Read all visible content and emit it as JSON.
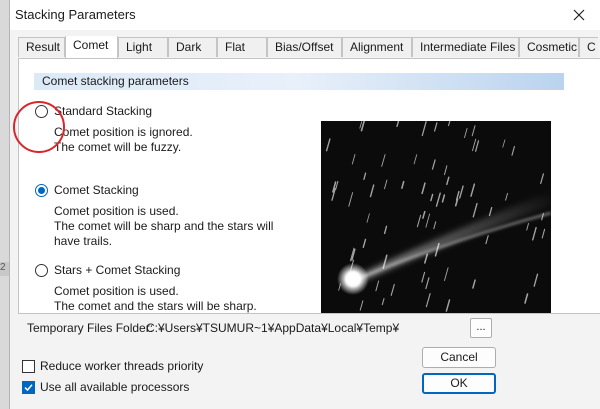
{
  "window": {
    "title": "Stacking Parameters"
  },
  "tabs": [
    {
      "label": "Result"
    },
    {
      "label": "Comet",
      "active": true
    },
    {
      "label": "Light"
    },
    {
      "label": "Dark"
    },
    {
      "label": "Flat"
    },
    {
      "label": "Bias/Offset"
    },
    {
      "label": "Alignment"
    },
    {
      "label": "Intermediate Files"
    },
    {
      "label": "Cosmetic"
    },
    {
      "label": "C"
    }
  ],
  "section": {
    "header": "Comet stacking parameters"
  },
  "options": [
    {
      "label": "Standard Stacking",
      "desc1": "Comet position is ignored.",
      "desc2": "The comet will be fuzzy.",
      "desc3": "",
      "checked": false
    },
    {
      "label": "Comet Stacking",
      "desc1": "Comet position is used.",
      "desc2": "The comet will be sharp and the stars will",
      "desc3": "have trails.",
      "checked": true
    },
    {
      "label": "Stars + Comet Stacking",
      "desc1": "Comet position is used.",
      "desc2": "The comet and the stars will be sharp.",
      "desc3": "",
      "checked": false
    }
  ],
  "temp": {
    "label": "Temporary Files Folder:",
    "path": "C:¥Users¥TSUMUR~1¥AppData¥Local¥Temp¥",
    "browse_label": "..."
  },
  "checks": [
    {
      "label": "Reduce worker threads priority",
      "checked": false
    },
    {
      "label": "Use all available processors",
      "checked": true
    }
  ],
  "buttons": {
    "cancel": "Cancel",
    "ok": "OK"
  },
  "edge": {
    "stub_text": "2"
  },
  "colors": {
    "accent": "#0067c0",
    "highlight": "#d8262d"
  },
  "icons": {
    "close": "close-icon",
    "check": "checkmark-icon"
  }
}
